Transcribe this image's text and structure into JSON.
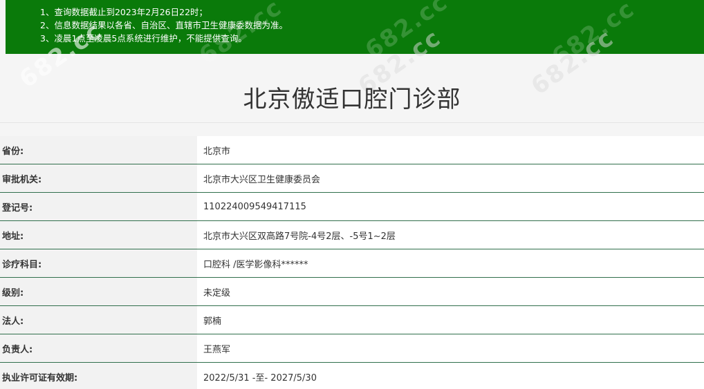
{
  "notice": {
    "lines": [
      "1、查询数据截止到2023年2月26日22时；",
      "2、信息数据结果以各省、自治区、直辖市卫生健康委数据为准。",
      "3、凌晨1点至凌晨5点系统进行维护，不能提供查询。"
    ],
    "background_color": "#0a7a0a"
  },
  "watermark_text": "682.cc",
  "title": "北京傲适口腔门诊部",
  "rows": [
    {
      "label": "省份:",
      "value": "北京市"
    },
    {
      "label": "审批机关:",
      "value": "北京市大兴区卫生健康委员会"
    },
    {
      "label": "登记号:",
      "value": "110224009549417115"
    },
    {
      "label": "地址:",
      "value": "北京市大兴区双高路7号院-4号2层、-5号1~2层"
    },
    {
      "label": "诊疗科目:",
      "value": "口腔科 /医学影像科******"
    },
    {
      "label": "级别:",
      "value": "未定级"
    },
    {
      "label": "法人:",
      "value": "郭楠"
    },
    {
      "label": "负责人:",
      "value": "王燕军"
    },
    {
      "label": "执业许可证有效期:",
      "value": "2022/5/31 -至- 2027/5/30"
    }
  ],
  "colors": {
    "row_border": "#2f6e4b",
    "label_bg": "#f2f2f2",
    "value_bg": "#ffffff"
  }
}
